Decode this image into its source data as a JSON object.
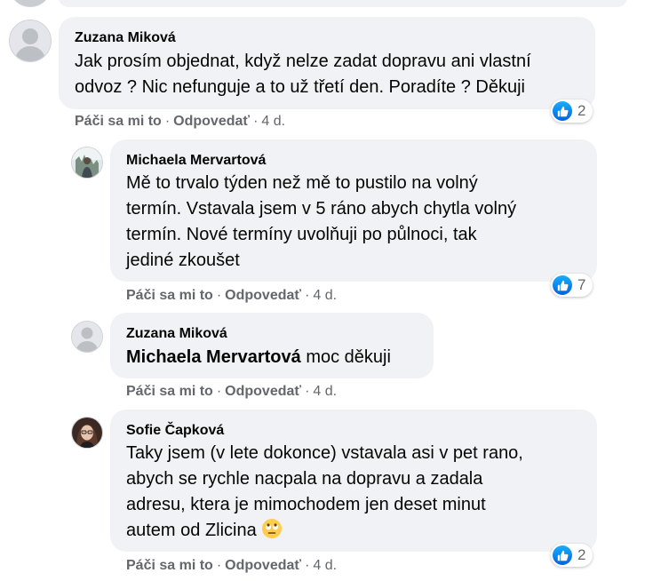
{
  "comments": [
    {
      "author": "Zuzana Miková",
      "lines": [
        "Jak prosím objednat, když nelze zadat dopravu ani vlastní",
        "odvoz ? Nic nefunguje a to už třetí den. Poradíte ? Děkuji"
      ],
      "actions": {
        "like": "Páči sa mi to",
        "reply": "Odpovedať",
        "time": "4 d."
      },
      "reaction_count": "2"
    },
    {
      "author": "Michaela Mervartová",
      "lines": [
        "Mě to trvalo týden než mě to pustilo na volný",
        "termín. Vstavala jsem v 5 ráno abych chytla volný",
        "termín. Nové termíny uvolňuji po půlnoci, tak",
        "jediné zkoušet"
      ],
      "actions": {
        "like": "Páči sa mi to",
        "reply": "Odpovedať",
        "time": "4 d."
      },
      "reaction_count": "7"
    },
    {
      "author": "Zuzana Miková",
      "mention": "Michaela Mervartová",
      "text": "moc děkuji",
      "actions": {
        "like": "Páči sa mi to",
        "reply": "Odpovedať",
        "time": "4 d."
      }
    },
    {
      "author": "Sofie Čapková",
      "lines": [
        "Taky jsem (v lete dokonce) vstavala asi v pet rano,",
        "abych se rychle nacpala na dopravu a zadala",
        "adresu, ktera je mimochodem jen deset minut",
        "autem od Zlicina"
      ],
      "emoji": "face-with-rolling-eyes-emoji",
      "actions": {
        "like": "Páči sa mi to",
        "reply": "Odpovedať",
        "time": "4 d."
      },
      "reaction_count": "2"
    }
  ],
  "colors": {
    "bubble": "#f0f2f5",
    "meta": "#65676b",
    "like": "#0571ed"
  },
  "icons": {
    "like": "thumbs-up-icon",
    "avatar_placeholder": "default-avatar-icon"
  }
}
